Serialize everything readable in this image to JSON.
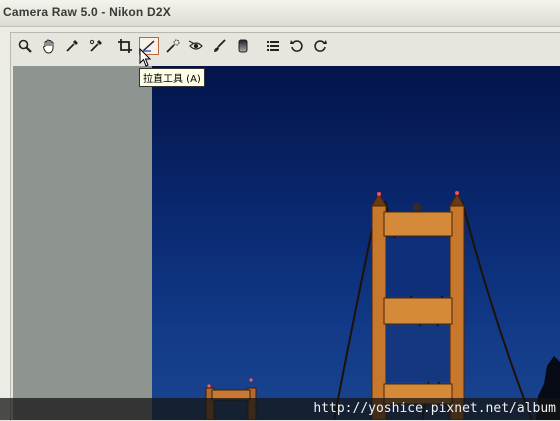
{
  "window": {
    "title": "Camera Raw 5.0  -  Nikon D2X"
  },
  "toolbar": {
    "tools": [
      {
        "name": "zoom-tool",
        "icon": "magnifier-icon"
      },
      {
        "name": "hand-tool",
        "icon": "hand-icon"
      },
      {
        "name": "white-balance-tool",
        "icon": "eyedropper-icon"
      },
      {
        "name": "color-sampler-tool",
        "icon": "color-sampler-icon"
      },
      {
        "name": "crop-tool",
        "icon": "crop-icon"
      },
      {
        "name": "straighten-tool",
        "icon": "straighten-icon",
        "active": true
      },
      {
        "name": "spot-removal-tool",
        "icon": "spot-removal-icon"
      },
      {
        "name": "red-eye-tool",
        "icon": "red-eye-icon"
      },
      {
        "name": "adjustment-brush-tool",
        "icon": "brush-icon"
      },
      {
        "name": "graduated-filter-tool",
        "icon": "graduated-filter-icon"
      },
      {
        "name": "preferences-tool",
        "icon": "list-icon"
      },
      {
        "name": "rotate-left-tool",
        "icon": "rotate-ccw-icon"
      },
      {
        "name": "rotate-right-tool",
        "icon": "rotate-cw-icon"
      }
    ],
    "active_color": "#b86b3a"
  },
  "tooltip": {
    "text": "拉直工具 (A)"
  },
  "watermark": {
    "text": "http://yoshice.pixnet.net/album"
  },
  "colors": {
    "sky_top": "#03144a",
    "sky_bottom": "#1a458f",
    "bridge_orange": "#c8782c",
    "panel_gray": "#8e9590"
  }
}
